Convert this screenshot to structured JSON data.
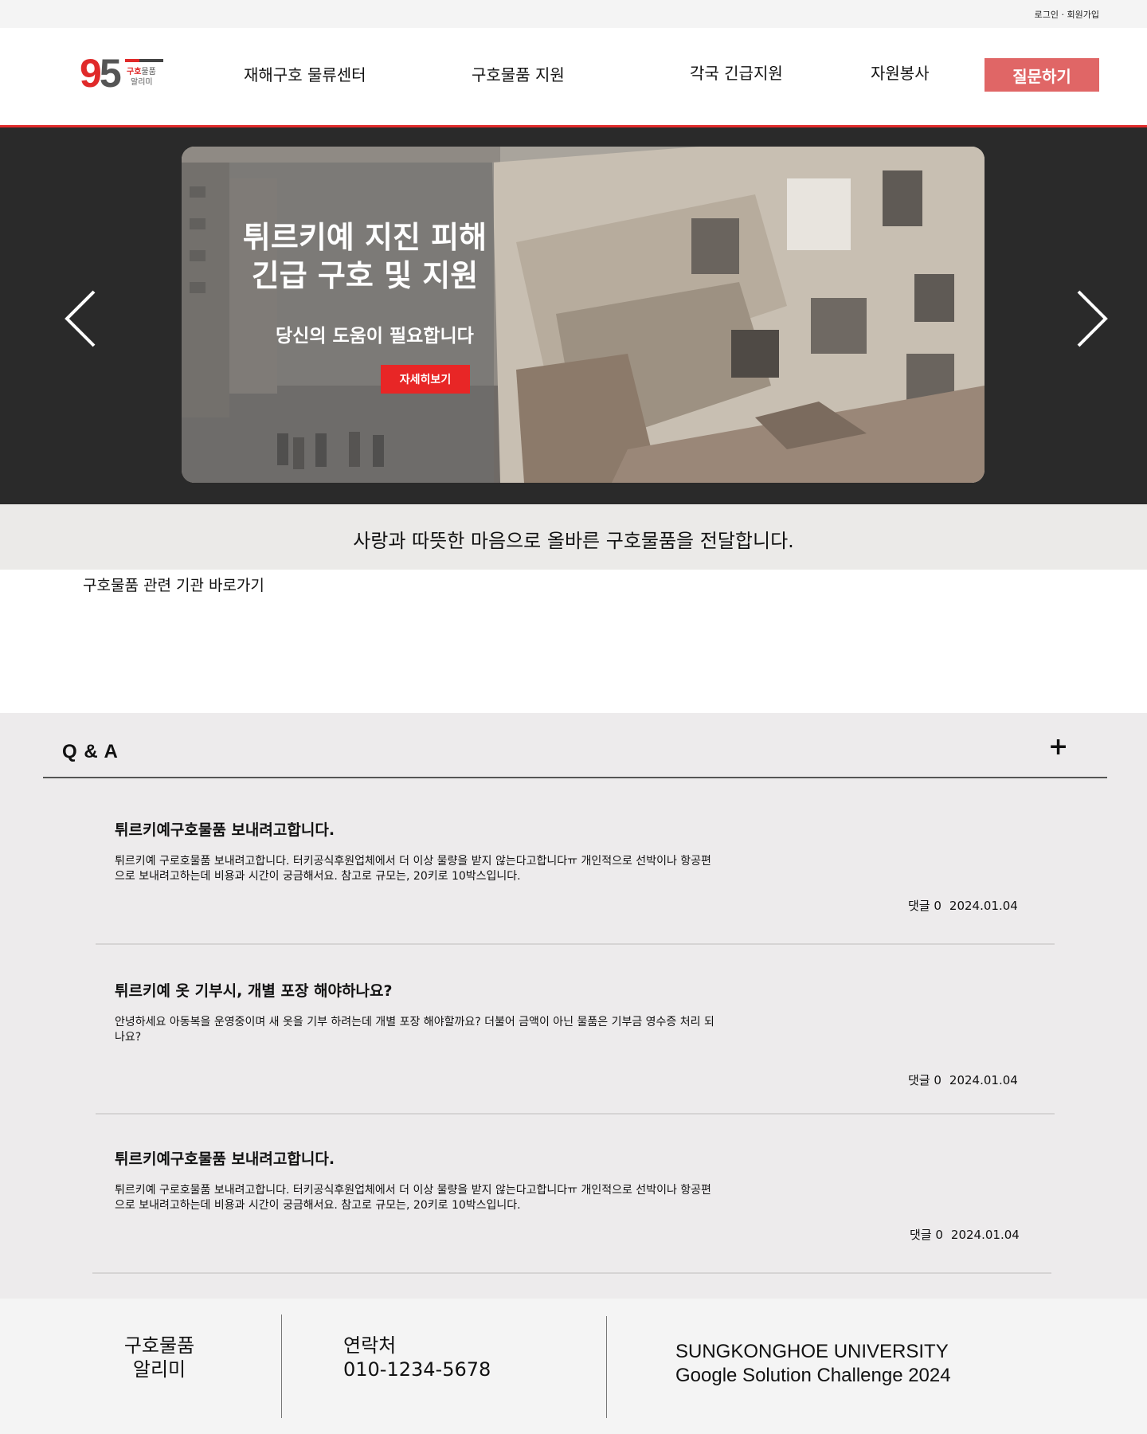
{
  "topbar": {
    "login": "로그인",
    "divider": "·",
    "signup": "회원가입"
  },
  "logo": {
    "number_a": "9",
    "number_b": "5",
    "line1_a": "구호",
    "line1_b": "물품",
    "line2": "알리미"
  },
  "nav": {
    "items": [
      {
        "label": "재해구호 물류센터"
      },
      {
        "label": "구호물품 지원"
      },
      {
        "label": "각국 긴급지원"
      },
      {
        "label": "자원봉사"
      }
    ],
    "ask_label": "질문하기"
  },
  "hero": {
    "title_line1": "튀르키예 지진 피해",
    "title_line2": "긴급 구호 및 지원",
    "subtitle": "당신의 도움이 필요합니다",
    "button_label": "자세히보기",
    "prev_icon": "chevron-left",
    "next_icon": "chevron-right"
  },
  "slogan": "사랑과 따뜻한 마음으로 올바른 구호물품을 전달합니다.",
  "organizations": {
    "title": "구호물품 관련 기관  바로가기"
  },
  "qna": {
    "title": "Q & A",
    "add_icon": "+",
    "posts": [
      {
        "title": "튀르키예구호물품 보내려고합니다.",
        "body": "튀르키예 구로호물품 보내려고합니다. 터키공식후원업체에서 더 이상 물량을 받지 않는다고합니다ㅠ 개인적으로 선박이나 항공편으로 보내려고하는데 비용과 시간이 궁금해서요. 참고로 규모는, 20키로 10박스입니다.",
        "comments": "댓글 0",
        "date": "2024.01.04"
      },
      {
        "title": "튀르키예 옷 기부시, 개별 포장 해야하나요?",
        "body": "안녕하세요 아동복을 운영중이며 새 옷을 기부 하려는데 개별 포장 해야할까요? 더불어 금액이 아닌 물품은 기부금 영수증 처리 되나요?",
        "comments": "댓글 0",
        "date": "2024.01.04"
      },
      {
        "title": "튀르키예구호물품 보내려고합니다.",
        "body": "튀르키예 구로호물품 보내려고합니다. 터키공식후원업체에서 더 이상 물량을 받지 않는다고합니다ㅠ 개인적으로 선박이나 항공편으로 보내려고하는데 비용과 시간이 궁금해서요. 참고로 규모는, 20키로 10박스입니다.",
        "comments": "댓글 0",
        "date": "2024.01.04"
      }
    ]
  },
  "footer": {
    "brand_line1": "구호물품",
    "brand_line2": "알리미",
    "contact_label": "연락처",
    "contact_phone": "010-1234-5678",
    "org_line1": "SUNGKONGHOE UNIVERSITY",
    "org_line2": "Google Solution Challenge 2024"
  },
  "colors": {
    "accent": "#e02a2a",
    "ask_button": "#e06666",
    "hero_bg": "#2a2a2a",
    "qna_bg": "#edebec"
  }
}
